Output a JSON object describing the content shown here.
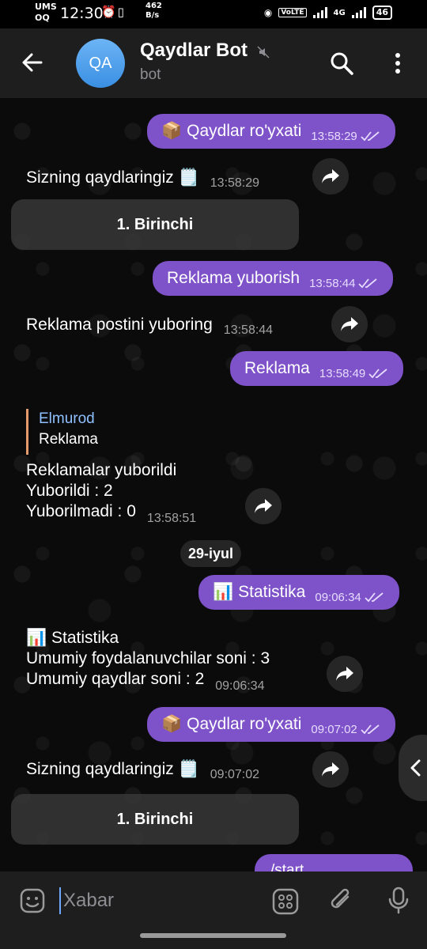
{
  "status_bar": {
    "carrier_top": "UMS",
    "carrier_bottom": "OQ",
    "time": "12:30",
    "speed_value": "462",
    "speed_unit": "B/s",
    "volte": "VoLTE",
    "network": "4G",
    "battery": "46"
  },
  "header": {
    "avatar_initials": "QA",
    "title": "Qaydlar Bot",
    "subtitle": "bot"
  },
  "messages": {
    "m1": {
      "emoji": "📦",
      "text": "Qaydlar ro'yxati",
      "time": "13:58:29"
    },
    "m2": {
      "text": "Sizning qaydlaringiz 🗒️",
      "time": "13:58:29"
    },
    "m2_button": "1. Birinchi",
    "m3": {
      "text": "Reklama yuborish",
      "time": "13:58:44"
    },
    "m4": {
      "text": "Reklama postini yuboring",
      "time": "13:58:44"
    },
    "m5": {
      "text": "Reklama",
      "time": "13:58:49"
    },
    "m6": {
      "reply_name": "Elmurod",
      "reply_text": "Reklama",
      "line1": "Reklamalar yuborildi",
      "line2": "Yuborildi : 2",
      "line3": "Yuborilmadi : 0",
      "time": "13:58:51"
    },
    "date_chip": "29-iyul",
    "m7": {
      "emoji": "📊",
      "text": "Statistika",
      "time": "09:06:34"
    },
    "m8": {
      "emoji": "📊",
      "line1": "Statistika",
      "line2": "Umumiy foydalanuvchilar soni : 3",
      "line3": "Umumiy qaydlar soni : 2",
      "time": "09:06:34"
    },
    "m9": {
      "emoji": "📦",
      "text": "Qaydlar ro'yxati",
      "time": "09:07:02"
    },
    "m10": {
      "text": "Sizning qaydlaringiz 🗒️",
      "time": "09:07:02"
    },
    "m10_button": "1. Birinchi",
    "m11_partial": "/start"
  },
  "input": {
    "placeholder": "Xabar"
  },
  "colors": {
    "outgoing": "#7e52c9",
    "header": "#1e1e1e",
    "background": "#0b0b0b"
  }
}
